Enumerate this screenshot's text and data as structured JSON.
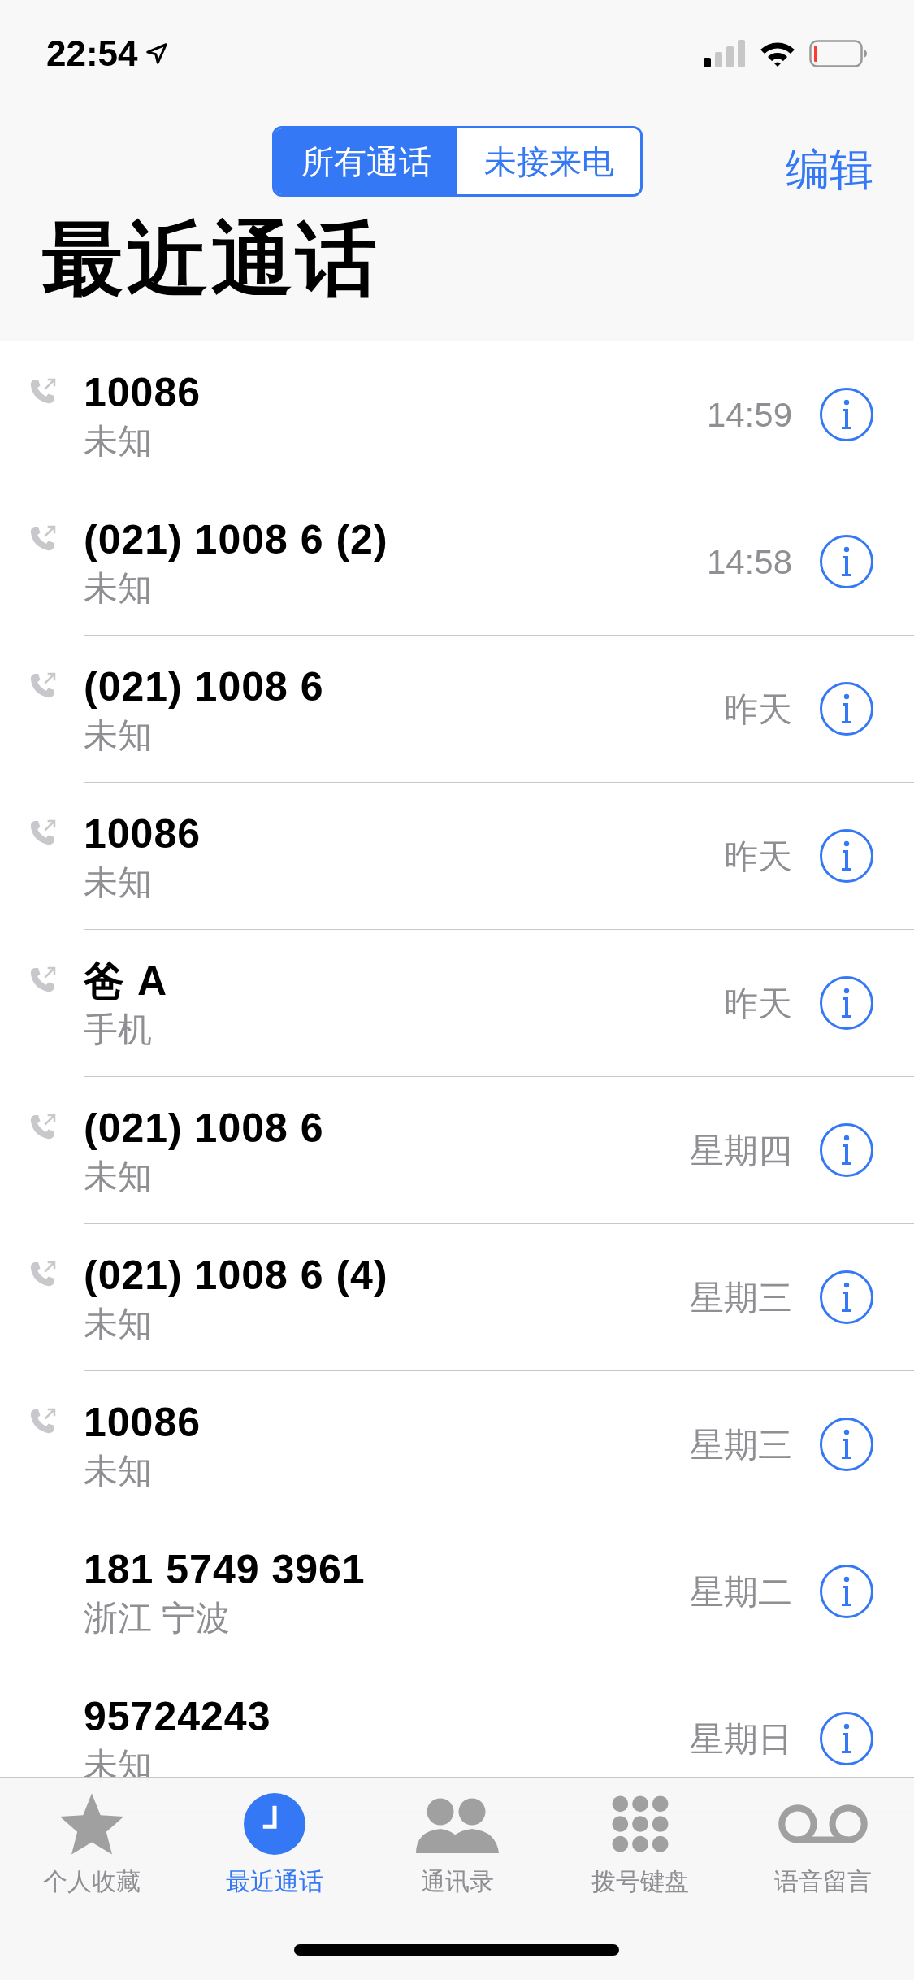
{
  "status_bar": {
    "time": "22:54"
  },
  "segments": [
    {
      "label": "所有通话",
      "selected": true
    },
    {
      "label": "未接来电",
      "selected": false
    }
  ],
  "edit_button": "编辑",
  "title": "最近通话",
  "calls": [
    {
      "name": "10086",
      "detail": "未知",
      "when": "14:59",
      "outgoing": true
    },
    {
      "name": "(021) 1008 6 (2)",
      "detail": "未知",
      "when": "14:58",
      "outgoing": true
    },
    {
      "name": "(021) 1008 6",
      "detail": "未知",
      "when": "昨天",
      "outgoing": true
    },
    {
      "name": "10086",
      "detail": "未知",
      "when": "昨天",
      "outgoing": true
    },
    {
      "name": "爸 A",
      "detail": "手机",
      "when": "昨天",
      "outgoing": true
    },
    {
      "name": "(021) 1008 6",
      "detail": "未知",
      "when": "星期四",
      "outgoing": true
    },
    {
      "name": "(021) 1008 6 (4)",
      "detail": "未知",
      "when": "星期三",
      "outgoing": true
    },
    {
      "name": "10086",
      "detail": "未知",
      "when": "星期三",
      "outgoing": true
    },
    {
      "name": "181 5749 3961",
      "detail": "浙江 宁波",
      "when": "星期二",
      "outgoing": false
    },
    {
      "name": "95724243",
      "detail": "未知",
      "when": "星期日",
      "outgoing": false
    }
  ],
  "tab_bar": [
    {
      "kind": "star",
      "label": "个人收藏",
      "selected": false
    },
    {
      "kind": "clock",
      "label": "最近通话",
      "selected": true
    },
    {
      "kind": "contacts",
      "label": "通讯录",
      "selected": false
    },
    {
      "kind": "keypad",
      "label": "拨号键盘",
      "selected": false
    },
    {
      "kind": "voicemail",
      "label": "语音留言",
      "selected": false
    }
  ]
}
